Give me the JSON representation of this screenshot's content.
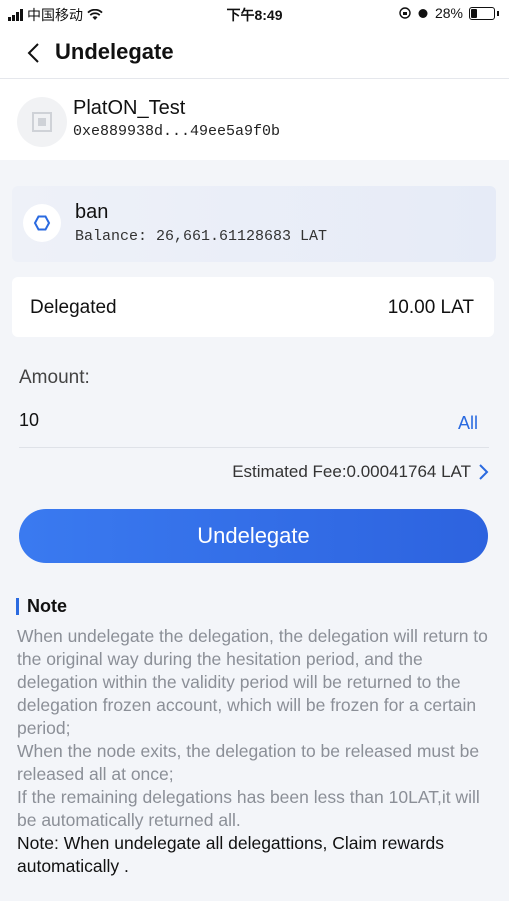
{
  "status_bar": {
    "carrier": "中国移动",
    "time": "下午8:49",
    "battery": "28%"
  },
  "header": {
    "title": "Undelegate"
  },
  "wallet": {
    "name": "PlatON_Test",
    "address": "0xe889938d...49ee5a9f0b"
  },
  "node": {
    "name": "ban",
    "balance": "Balance: 26,661.61128683 LAT"
  },
  "delegated": {
    "label": "Delegated",
    "value": "10.00 LAT"
  },
  "amount": {
    "label": "Amount:",
    "value": "10",
    "all_label": "All"
  },
  "fee": {
    "text": "Estimated Fee:0.00041764 LAT"
  },
  "undelegate_button": "Undelegate",
  "note": {
    "title": "Note",
    "paragraph1": "When undelegate the delegation, the delegation will return to the original way during the hesitation period, and the delegation within the validity period will be returned to the delegation frozen account, which will be frozen for a certain period;",
    "paragraph2": "When the node exits, the delegation to be released must be released all at once;",
    "paragraph3": "If the remaining delegations has been less than 10LAT,it will be automatically returned all.",
    "paragraph4": "Note: When undelegate all delegattions, Claim rewards automatically ."
  },
  "colors": {
    "accent": "#2a6ae0",
    "button": "#3371e8"
  }
}
